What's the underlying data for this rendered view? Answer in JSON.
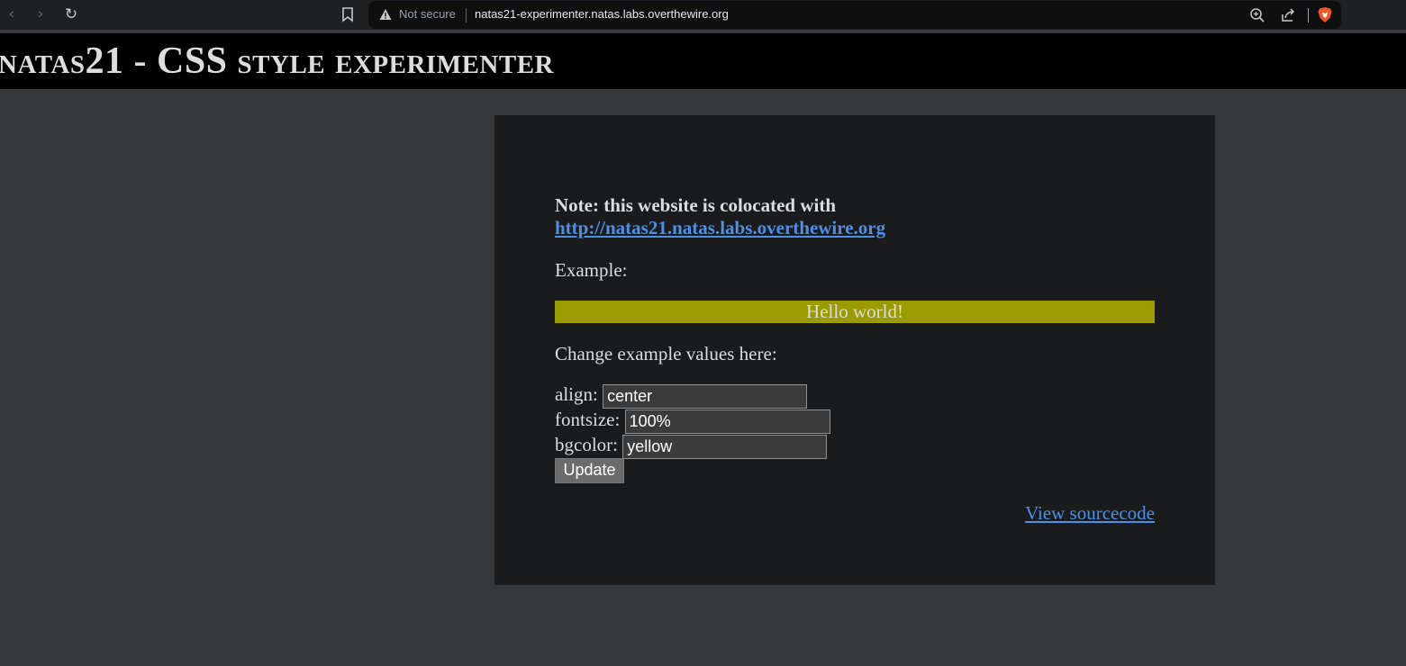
{
  "browser": {
    "security_label": "Not secure",
    "url": "natas21-experimenter.natas.labs.overthewire.org",
    "icons": [
      "back-icon",
      "forward-icon",
      "reload-icon",
      "bookmark-icon",
      "warning-icon",
      "zoom-icon",
      "share-icon",
      "brave-shield-icon"
    ]
  },
  "header": {
    "title": "natas21 - CSS style experimenter"
  },
  "main": {
    "note_prefix": "Note: this website is colocated with",
    "note_link": "http://natas21.natas.labs.overthewire.org",
    "example_label": "Example:",
    "example_text": "Hello world!",
    "example_bgcolor": "#9b9b00",
    "change_label": "Change example values here:",
    "form": {
      "align_label": "align:",
      "align_value": "center",
      "fontsize_label": "fontsize:",
      "fontsize_value": "100%",
      "bgcolor_label": "bgcolor:",
      "bgcolor_value": "yellow",
      "update_label": "Update"
    },
    "view_source_label": "View sourcecode"
  },
  "colors": {
    "page_bg": "#35393c",
    "header_bg": "#000000",
    "content_bg": "#1b1c1e",
    "link": "#4e8fe8",
    "text": "#dddddd"
  }
}
